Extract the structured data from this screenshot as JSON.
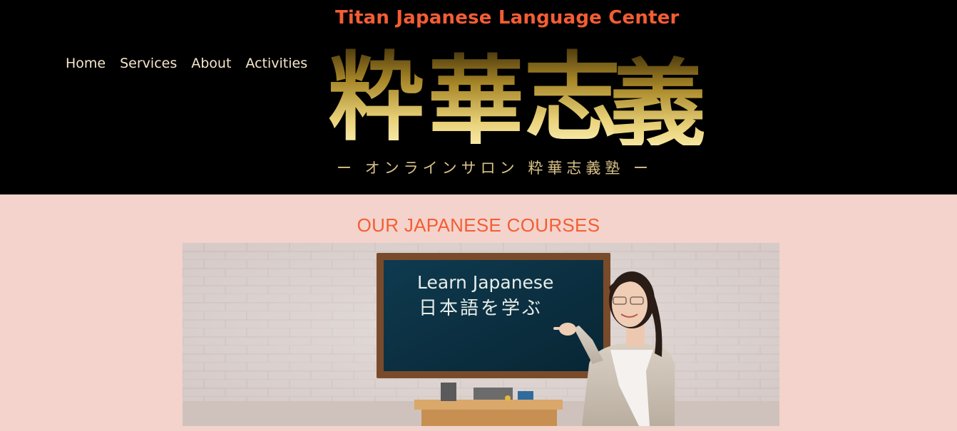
{
  "header": {
    "site_title": "Titan Japanese Language Center",
    "nav": [
      "Home",
      "Services",
      "About",
      "Activities"
    ],
    "logo_kanji": [
      "粋",
      "華",
      "志",
      "義"
    ],
    "logo_subtitle": "ー オンラインサロン 粋華志義塾 ー"
  },
  "courses": {
    "title": "OUR JAPANESE COURSES",
    "blackboard_line1": "Learn Japanese",
    "blackboard_line2": "日本語を学ぶ"
  },
  "colors": {
    "header_bg": "#000000",
    "accent": "#f45d34",
    "nav_text": "#f5e6cc",
    "page_bg": "#f3d3cb",
    "gold": "#d9c287"
  }
}
